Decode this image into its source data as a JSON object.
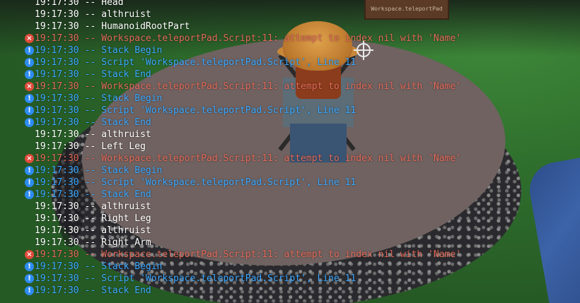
{
  "scene": {
    "sign_text": "Workspace.teleportPad",
    "accent_colors": {
      "error": "#e36a5a",
      "trace": "#3aa7ff",
      "info": "#ffffff"
    }
  },
  "console": {
    "lines": [
      {
        "type": "info",
        "time": "19:17:30",
        "text": "Head"
      },
      {
        "type": "info",
        "time": "19:17:30",
        "text": "althruist"
      },
      {
        "type": "info",
        "time": "19:17:30",
        "text": "HumanoidRootPart"
      },
      {
        "type": "error",
        "time": "19:17:30",
        "text": "Workspace.teleportPad.Script:11: attempt to index nil with 'Name'"
      },
      {
        "type": "trace",
        "time": "19:17:30",
        "text": "Stack Begin"
      },
      {
        "type": "trace",
        "time": "19:17:30",
        "text": "Script 'Workspace.teleportPad.Script', Line 11"
      },
      {
        "type": "trace",
        "time": "19:17:30",
        "text": "Stack End"
      },
      {
        "type": "error",
        "time": "19:17:30",
        "text": "Workspace.teleportPad.Script:11: attempt to index nil with 'Name'"
      },
      {
        "type": "trace",
        "time": "19:17:30",
        "text": "Stack Begin"
      },
      {
        "type": "trace",
        "time": "19:17:30",
        "text": "Script 'Workspace.teleportPad.Script', Line 11"
      },
      {
        "type": "trace",
        "time": "19:17:30",
        "text": "Stack End"
      },
      {
        "type": "info",
        "time": "19:17:30",
        "text": "althruist"
      },
      {
        "type": "info",
        "time": "19:17:30",
        "text": "Left Leg"
      },
      {
        "type": "error",
        "time": "19:17:30",
        "text": "Workspace.teleportPad.Script:11: attempt to index nil with 'Name'"
      },
      {
        "type": "trace",
        "time": "19:17:30",
        "text": "Stack Begin"
      },
      {
        "type": "trace",
        "time": "19:17:30",
        "text": "Script 'Workspace.teleportPad.Script', Line 11"
      },
      {
        "type": "trace",
        "time": "19:17:30",
        "text": "Stack End"
      },
      {
        "type": "info",
        "time": "19:17:30",
        "text": "althruist"
      },
      {
        "type": "info",
        "time": "19:17:30",
        "text": "Right Leg"
      },
      {
        "type": "info",
        "time": "19:17:30",
        "text": "althruist"
      },
      {
        "type": "info",
        "time": "19:17:30",
        "text": "Right Arm"
      },
      {
        "type": "error",
        "time": "19:17:30",
        "text": "Workspace.teleportPad.Script:11: attempt to index nil with 'Name'"
      },
      {
        "type": "trace",
        "time": "19:17:30",
        "text": "Stack Begin"
      },
      {
        "type": "trace",
        "time": "19:17:30",
        "text": "Script 'Workspace.teleportPad.Script', Line 11"
      },
      {
        "type": "trace",
        "time": "19:17:30",
        "text": "Stack End"
      }
    ],
    "separator": "--",
    "icons": {
      "error": "error-x-icon",
      "trace": "info-exclamation-icon"
    },
    "badge_glyphs": {
      "error": "×",
      "trace": "!"
    }
  }
}
